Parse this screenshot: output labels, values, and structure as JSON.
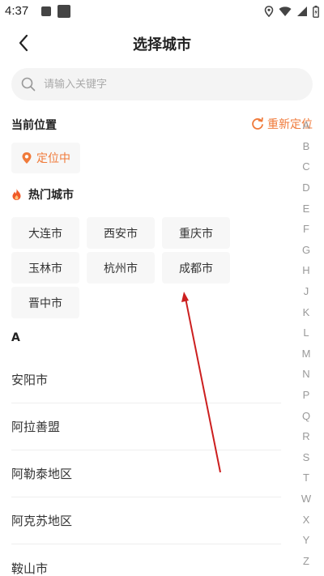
{
  "status_bar": {
    "time": "4:37"
  },
  "header": {
    "title": "选择城市"
  },
  "search": {
    "placeholder": "请输入关键字"
  },
  "current_location": {
    "label": "当前位置",
    "relocate_label": "重新定位",
    "locating_label": "定位中"
  },
  "hot_cities": {
    "title": "热门城市",
    "items": [
      "大连市",
      "西安市",
      "重庆市",
      "玉林市",
      "杭州市",
      "成都市",
      "晋中市"
    ]
  },
  "city_section": {
    "letter": "A",
    "cities": [
      "安阳市",
      "阿拉善盟",
      "阿勒泰地区",
      "阿克苏地区",
      "鞍山市"
    ]
  },
  "index_letters": [
    "A",
    "B",
    "C",
    "D",
    "E",
    "F",
    "G",
    "H",
    "J",
    "K",
    "L",
    "M",
    "N",
    "P",
    "Q",
    "R",
    "S",
    "T",
    "W",
    "X",
    "Y",
    "Z"
  ],
  "colors": {
    "accent": "#f07a3a",
    "annotation_arrow": "#cc1f1f"
  }
}
